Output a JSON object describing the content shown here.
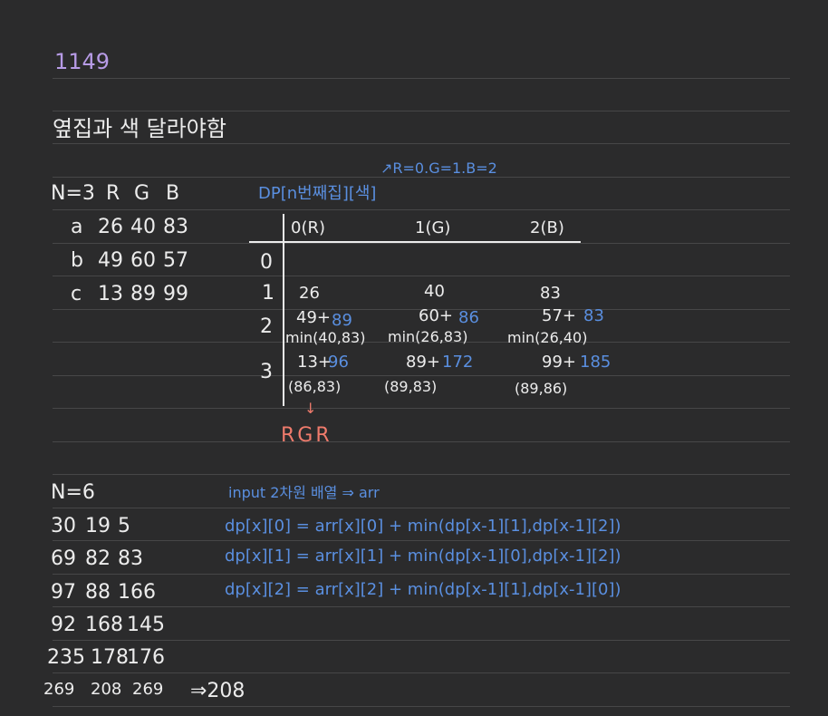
{
  "problem_number": "1149",
  "rule_text": "옆집과 색 달라야함",
  "index_note": "↗R=0.G=1.B=2",
  "dp_label": "DP[n번째집][색]",
  "example1": {
    "header": [
      "N=3",
      "R",
      "G",
      "B"
    ],
    "rows": [
      [
        "a",
        "26",
        "40",
        "83"
      ],
      [
        "b",
        "49",
        "60",
        "57"
      ],
      [
        "c",
        "13",
        "89",
        "99"
      ]
    ]
  },
  "table": {
    "col_headers": [
      "0(R)",
      "1(G)",
      "2(B)"
    ],
    "row_headers": [
      "0",
      "1",
      "2",
      "3"
    ],
    "row1": [
      "26",
      "40",
      "83"
    ],
    "row2": {
      "base": [
        "49+",
        "60+",
        "57+"
      ],
      "sum": [
        "89",
        "86",
        "83"
      ],
      "min": [
        "min(40,83)",
        "min(26,83)",
        "min(26,40)"
      ]
    },
    "row3": {
      "base": [
        "13+",
        "89+",
        "99+"
      ],
      "sum": [
        "96",
        "172",
        "185"
      ],
      "min": [
        "(86,83)",
        "(89,83)",
        "(89,86)"
      ]
    },
    "down_arrow": "↓",
    "answer_path": "RGR"
  },
  "example2": {
    "label": "N=6",
    "rows": [
      [
        "30",
        "19",
        "5"
      ],
      [
        "69",
        "82",
        "83"
      ],
      [
        "97",
        "88",
        "166"
      ],
      [
        "92",
        "168",
        "145"
      ],
      [
        "235",
        "178",
        "176"
      ],
      [
        "269",
        "208",
        "269"
      ]
    ],
    "result": "⇒208"
  },
  "code": {
    "input_note": "input 2차원 배열 ⇒ arr",
    "lines": [
      "dp[x][0] = arr[x][0] + min(dp[x-1][1],dp[x-1][2])",
      "dp[x][1] = arr[x][1] + min(dp[x-1][0],dp[x-1][2])",
      "dp[x][2] = arr[x][2] + min(dp[x-1][1],dp[x-1][0])"
    ]
  },
  "colors": {
    "background": "#2b2b2c",
    "ink_white": "#ececec",
    "ink_blue": "#5a8fe0",
    "ink_purple": "#b79be6",
    "ink_red": "#ef7b6c",
    "ruled_line": "#474748"
  }
}
